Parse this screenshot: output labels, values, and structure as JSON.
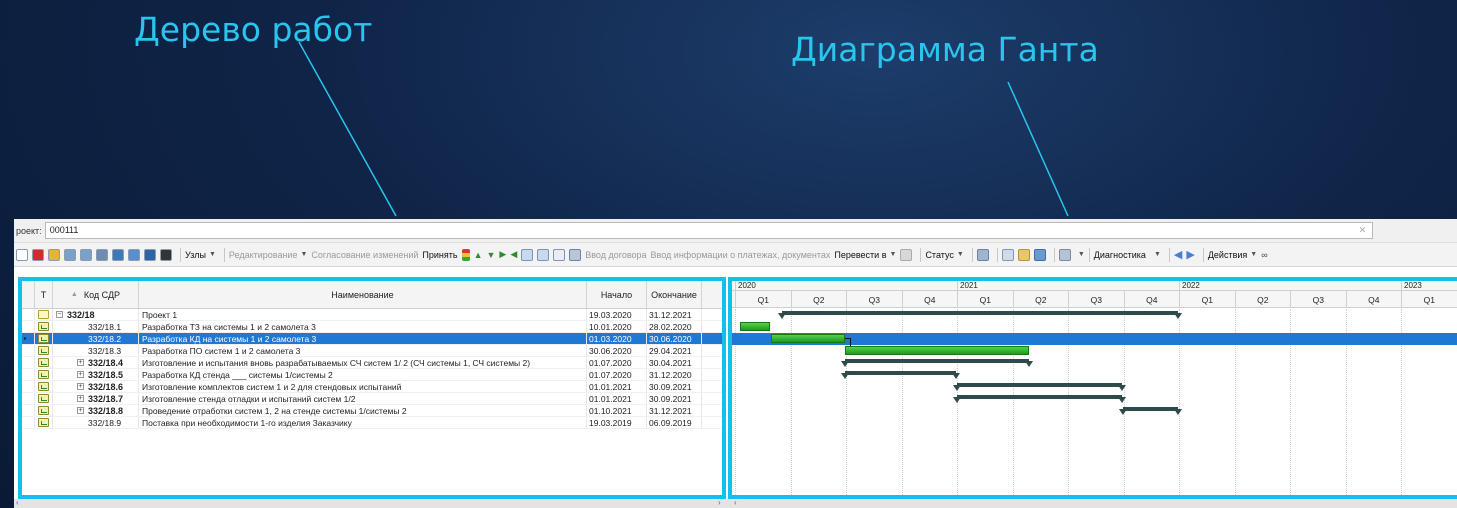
{
  "slide": {
    "tree_label": "Дерево работ",
    "gantt_label": "Диаграмма Ганта",
    "accent_color": "#29c5ee"
  },
  "project": {
    "label": "роект:",
    "value": "000111",
    "clear_icon": "close-icon"
  },
  "toolbar": {
    "items": [
      {
        "kind": "icon",
        "name": "new-document-icon",
        "color": "#ffffff"
      },
      {
        "kind": "icon",
        "name": "delete-icon",
        "color": "#d12b2b"
      },
      {
        "kind": "icon",
        "name": "properties-icon",
        "color": "#e6b23a"
      },
      {
        "kind": "icon",
        "name": "table-icon",
        "color": "#7aa2c8"
      },
      {
        "kind": "icon",
        "name": "table-icon",
        "color": "#7aa2c8"
      },
      {
        "kind": "icon",
        "name": "collapse-icon",
        "color": "#6f8db0"
      },
      {
        "kind": "icon",
        "name": "hierarchy-icon",
        "color": "#3d78b8"
      },
      {
        "kind": "icon",
        "name": "window-icon",
        "color": "#5b8ecf"
      },
      {
        "kind": "icon",
        "name": "grid-icon",
        "color": "#2f62a6"
      },
      {
        "kind": "icon",
        "name": "list-icon",
        "color": "#333333"
      }
    ],
    "nodes_label": "Узлы",
    "edit_label": "Редактирование",
    "approval_label": "Согласование изменений",
    "accept_label": "Принять",
    "contract_label": "Ввод договора",
    "payments_label": "Ввод информации о платежах, документах",
    "transfer_label": "Перевести в",
    "status_label": "Статус",
    "diagnostics_label": "Диагностика",
    "actions_label": "Действия"
  },
  "tree": {
    "columns": {
      "t": "T",
      "code": "Код СДР",
      "name": "Наименование",
      "start": "Начало",
      "end": "Окончание"
    },
    "rows": [
      {
        "code": "332/18",
        "name": "Проект 1",
        "start": "19.03.2020",
        "end": "31.12.2021"
      },
      {
        "code": "332/18.1",
        "name": "Разработка ТЗ на системы 1 и 2 самолета 3",
        "start": "10.01.2020",
        "end": "28.02.2020"
      },
      {
        "code": "332/18.2",
        "name": "Разработка КД на системы 1 и 2 самолета 3",
        "start": "01.03.2020",
        "end": "30.06.2020"
      },
      {
        "code": "332/18.3",
        "name": "Разработка ПО систем 1 и 2 самолета 3",
        "start": "30.06.2020",
        "end": "29.04.2021"
      },
      {
        "code": "332/18.4",
        "name": "Изготовление и испытания вновь разрабатываемых СЧ систем 1/ 2 (СЧ системы 1, СЧ системы 2)",
        "start": "01.07.2020",
        "end": "30.04.2021"
      },
      {
        "code": "332/18.5",
        "name": "Разработка КД стенда ___ системы 1/системы 2",
        "start": "01.07.2020",
        "end": "31.12.2020"
      },
      {
        "code": "332/18.6",
        "name": "Изготовление комплектов систем 1 и 2 для стендовых испытаний",
        "start": "01.01.2021",
        "end": "30.09.2021"
      },
      {
        "code": "332/18.7",
        "name": "Изготовление стенда отладки и испытаний систем 1/2",
        "start": "01.01.2021",
        "end": "30.09.2021"
      },
      {
        "code": "332/18.8",
        "name": "Проведение отработки систем 1, 2 на стенде системы 1/системы 2",
        "start": "01.10.2021",
        "end": "31.12.2021"
      },
      {
        "code": "332/18.9",
        "name": "Поставка при необходимости 1-го изделия Заказчику",
        "start": "19.03.2019",
        "end": "06.09.2019"
      }
    ]
  },
  "gantt": {
    "years": [
      "2020",
      "2021",
      "2022",
      "2023"
    ],
    "quarters": [
      "Q1",
      "Q2",
      "Q3",
      "Q4",
      "Q1",
      "Q2",
      "Q3",
      "Q4",
      "Q1",
      "Q2",
      "Q3",
      "Q4",
      "Q1"
    ],
    "scale_start": "2020-01-01",
    "bars": [
      {
        "type": "summary",
        "start": "2020-03-19",
        "end": "2021-12-31"
      },
      {
        "type": "task",
        "start": "2020-01-10",
        "end": "2020-02-28"
      },
      {
        "type": "task",
        "start": "2020-03-01",
        "end": "2020-06-30"
      },
      {
        "type": "task",
        "start": "2020-06-30",
        "end": "2021-04-29"
      },
      {
        "type": "summary",
        "start": "2020-07-01",
        "end": "2021-04-30"
      },
      {
        "type": "summary",
        "start": "2020-07-01",
        "end": "2020-12-31"
      },
      {
        "type": "summary",
        "start": "2021-01-01",
        "end": "2021-09-30"
      },
      {
        "type": "summary",
        "start": "2021-01-01",
        "end": "2021-09-30"
      },
      {
        "type": "summary",
        "start": "2021-10-01",
        "end": "2021-12-31"
      },
      {
        "type": "none",
        "start": "2019-03-19",
        "end": "2019-09-06"
      }
    ],
    "colors": {
      "summary": "#2f4a4a",
      "task": "#2bb52b",
      "selection": "#1e78d4"
    }
  }
}
